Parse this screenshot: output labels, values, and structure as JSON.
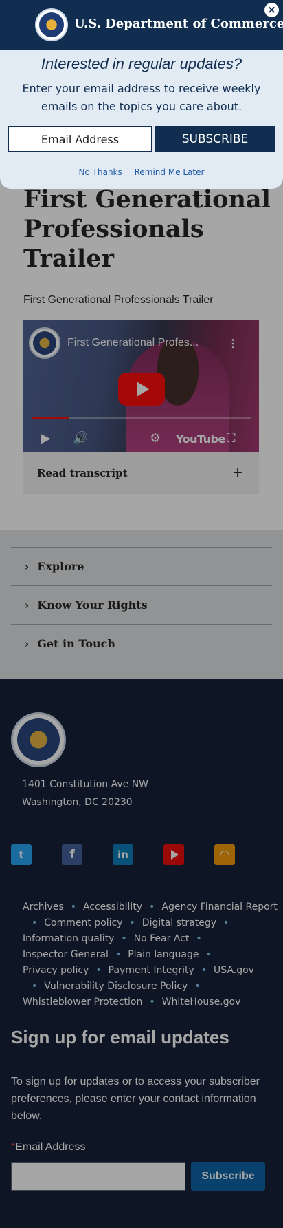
{
  "popup": {
    "brand": "U.S. Department of Commerce",
    "close_label": "×",
    "heading": "Interested in regular updates?",
    "description": "Enter your email address to receive weekly emails on the topics you care about.",
    "email_placeholder": "Email Address",
    "subscribe_label": "SUBSCRIBE",
    "no_thanks": "No Thanks",
    "remind_later": "Remind Me Later"
  },
  "main": {
    "title": "First Generational Professionals Trailer",
    "subtitle": "First Generational Professionals Trailer",
    "video": {
      "title": "First Generational Profes...",
      "more": "⋮",
      "youtube_label": "YouTube",
      "progress": 0.17
    },
    "transcript_label": "Read transcript",
    "transcript_toggle": "+"
  },
  "accordion": {
    "items": [
      {
        "label": "Explore",
        "chevron": "›"
      },
      {
        "label": "Know Your Rights",
        "chevron": "›"
      },
      {
        "label": "Get in Touch",
        "chevron": "›"
      }
    ]
  },
  "footer": {
    "address_line1": "1401 Constitution Ave NW",
    "address_line2": "Washington, DC 20230",
    "social": {
      "twitter": "t",
      "facebook": "f",
      "linkedin": "in",
      "rss": "◠"
    },
    "links": [
      "Archives",
      "Accessibility",
      "Agency Financial Report",
      "Comment policy",
      "Digital strategy",
      "Information quality",
      "No Fear Act",
      "Inspector General",
      "Plain language",
      "Privacy policy",
      "Payment Integrity",
      "USA.gov",
      "Vulnerability Disclosure Policy",
      "Whistleblower Protection",
      "WhiteHouse.gov"
    ],
    "signup_title": "Sign up for email updates",
    "signup_desc": "To sign up for updates or to access your subscriber preferences, please enter your contact information below.",
    "email_required": "*",
    "email_label": "Email Address",
    "subscribe_label": "Subscribe"
  },
  "colors": {
    "navy": "#112e51",
    "footer_bg": "#0b1730",
    "link_dot": "#7cc4e8",
    "youtube_red": "#ff0000"
  }
}
